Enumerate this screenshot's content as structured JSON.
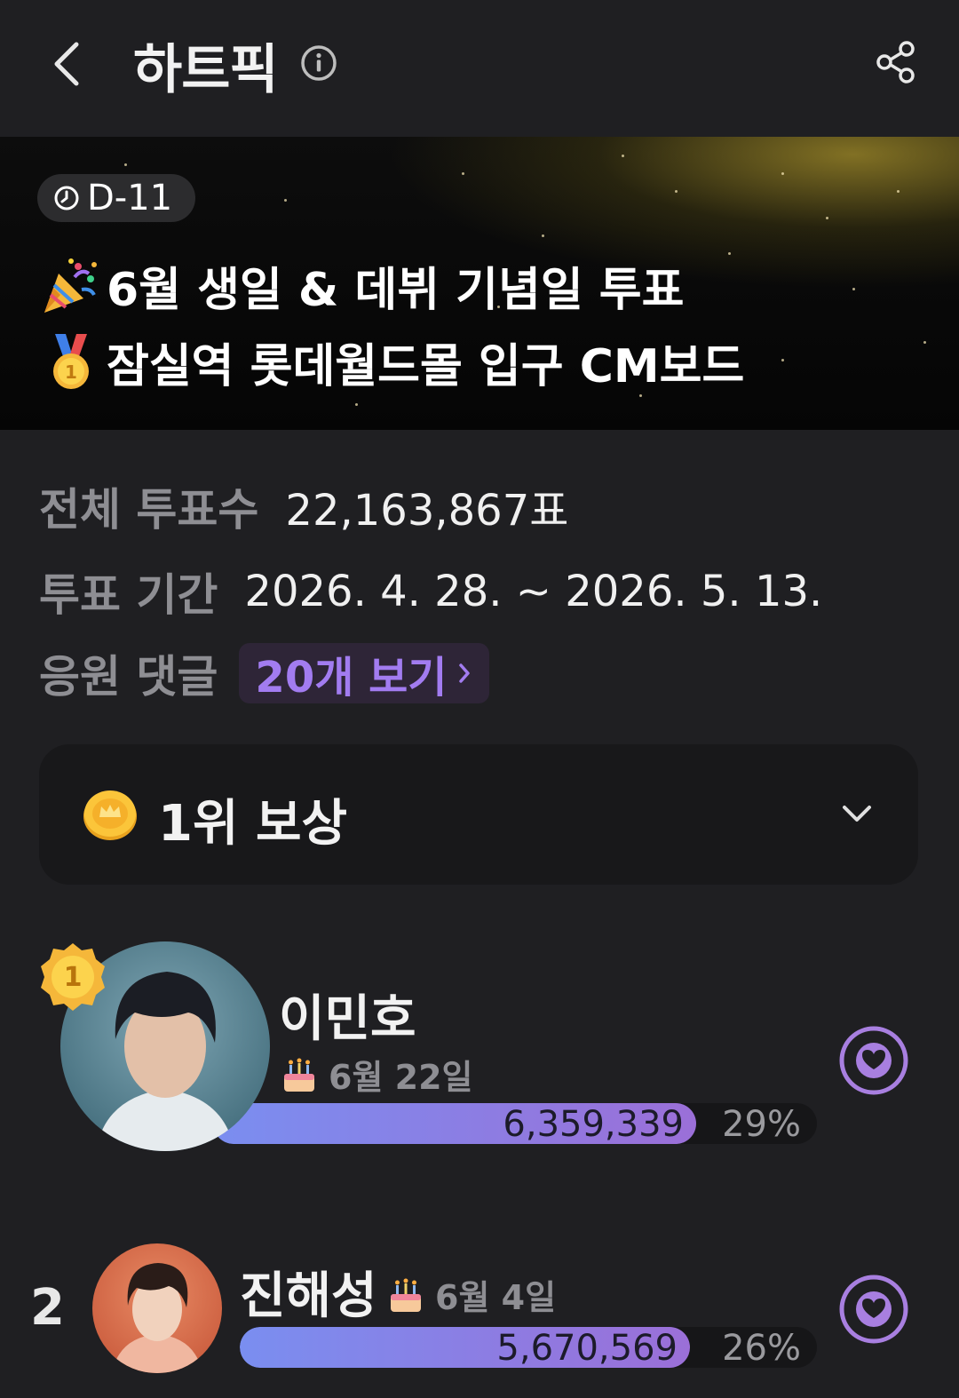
{
  "header": {
    "title": "하트픽"
  },
  "banner": {
    "dday": "D-11",
    "line1": "6월 생일 & 데뷔 기념일 투표",
    "line2": "잠실역 롯데월드몰 입구 CM보드"
  },
  "stats": {
    "total_label": "전체 투표수",
    "total_value": "22,163,867표",
    "period_label": "투표 기간",
    "period_value": "2026. 4. 28. ~ 2026. 5. 13.",
    "comments_label": "응원 댓글",
    "comments_button": "20개 보기"
  },
  "reward": {
    "title": "1위 보상"
  },
  "candidates": [
    {
      "rank": "1",
      "name": "이민호",
      "birthday": "6월 22일",
      "votes": "6,359,339",
      "percent": "29%",
      "share": 0.29
    },
    {
      "rank": "2",
      "name": "진해성",
      "birthday": "6월 4일",
      "votes": "5,670,569",
      "percent": "26%",
      "share": 0.26
    }
  ],
  "colors": {
    "background": "#1f1f22",
    "accent_purple": "#a27cf0",
    "bar_start": "#7a8ef0",
    "bar_end": "#9b6fd8",
    "vote_ring": "#a87fe0"
  },
  "icons": {
    "back": "chevron-left-icon",
    "info": "info-icon",
    "share": "share-icon",
    "dday": "clock-icon",
    "line1": "party-popper-icon",
    "line2": "gold-medal-icon",
    "reward": "coin-icon",
    "expand": "chevron-down-icon",
    "birthday": "cake-icon",
    "vote": "heart-vote-icon"
  }
}
